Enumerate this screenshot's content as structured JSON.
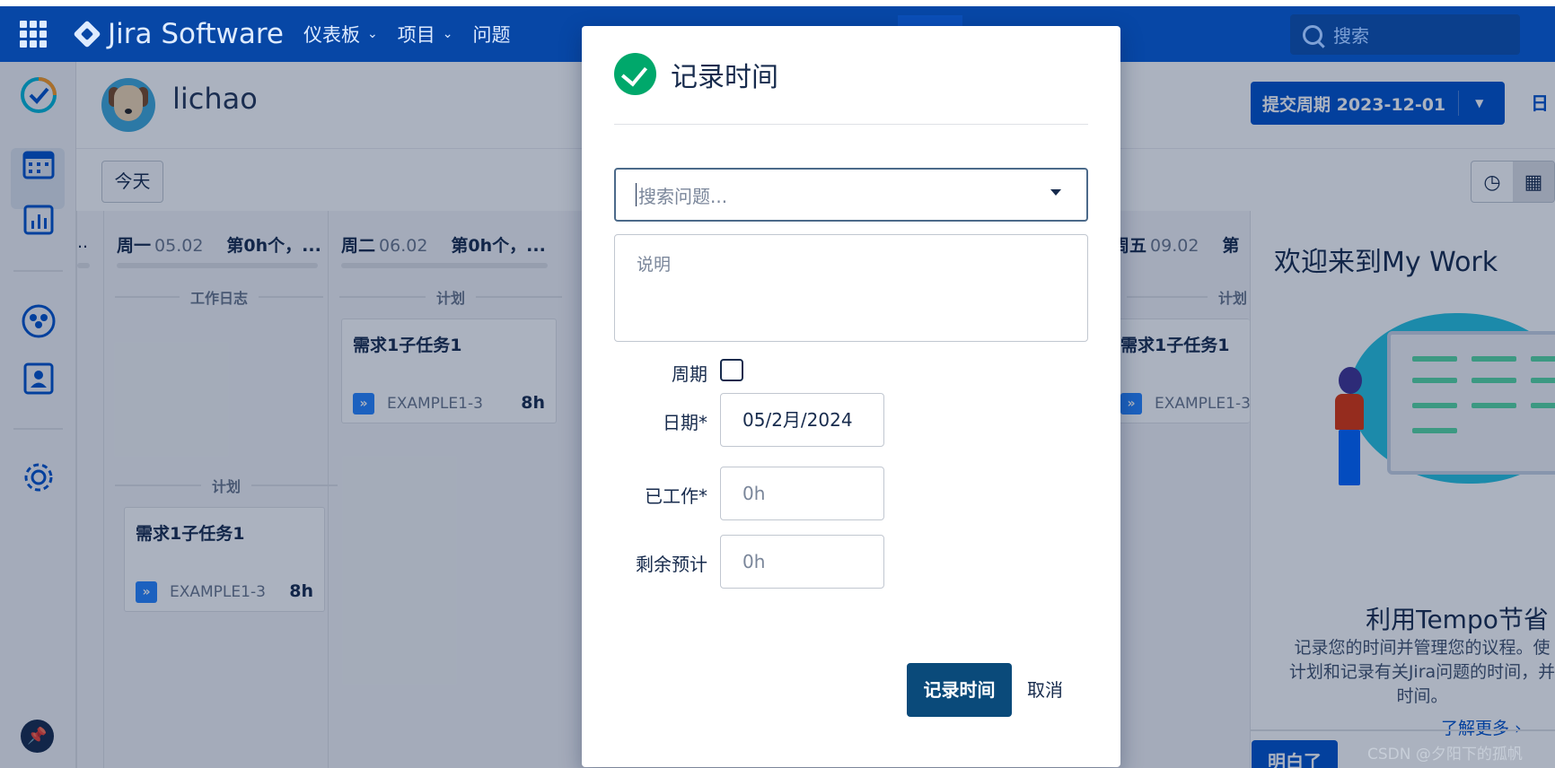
{
  "topnav": {
    "logo_text": "Jira Software",
    "items": [
      {
        "label": "仪表板",
        "chevron": "chevron-down-icon"
      },
      {
        "label": "项目",
        "chevron": "chevron-down-icon"
      },
      {
        "label": "问题"
      }
    ],
    "search_placeholder": "搜索",
    "bar_color": "#0747a6"
  },
  "header": {
    "user_name": "lichao",
    "period_button": "提交周期 2023-12-01",
    "period_tab": "日"
  },
  "toolbar": {
    "today_label": "今天"
  },
  "calendar": {
    "columns": [
      {
        "prefix": "..",
        "day": "",
        "date": "",
        "count": ""
      },
      {
        "day": "周一",
        "date": "05.02",
        "count": "第0h个，..."
      },
      {
        "day": "周二",
        "date": "06.02",
        "count": "第0h个，..."
      },
      {
        "day": "周五",
        "date": "09.02",
        "count": "第"
      }
    ],
    "mon_sections": {
      "worklog_label": "工作日志",
      "plan_label": "计划"
    },
    "tue_sections": {
      "plan_label": "计划"
    },
    "fri_sections": {
      "plan_label": "计划"
    },
    "cards": {
      "mon_plan": {
        "title": "需求1子任务1",
        "key": "EXAMPLE1-3",
        "hours": "8h"
      },
      "tue_plan": {
        "title": "需求1子任务1",
        "key": "EXAMPLE1-3",
        "hours": "8h"
      },
      "fri_plan": {
        "title": "需求1子任务1",
        "key": "EXAMPLE1-3"
      }
    }
  },
  "welcome": {
    "heading": "欢迎来到My Work",
    "subheading": "利用Tempo节省",
    "body_line1": "记录您的时间并管理您的议程。使",
    "body_line2": "计划和记录有关Jira问题的时间，并",
    "body_line3": "时间。",
    "learn_more": "了解更多 ›",
    "got_it": "明白了"
  },
  "modal": {
    "title": "记录时间",
    "search_placeholder": "搜索问题...",
    "description_placeholder": "说明",
    "fields": {
      "period_label": "周期",
      "date_label": "日期*",
      "date_value": "05/2月/2024",
      "worked_label": "已工作*",
      "worked_placeholder": "0h",
      "remaining_label": "剩余预计",
      "remaining_placeholder": "0h"
    },
    "submit_label": "记录时间",
    "cancel_label": "取消",
    "accent_color": "#00a86b",
    "submit_color": "#0a4a7a"
  },
  "watermark": "CSDN @夕阳下的孤帆"
}
